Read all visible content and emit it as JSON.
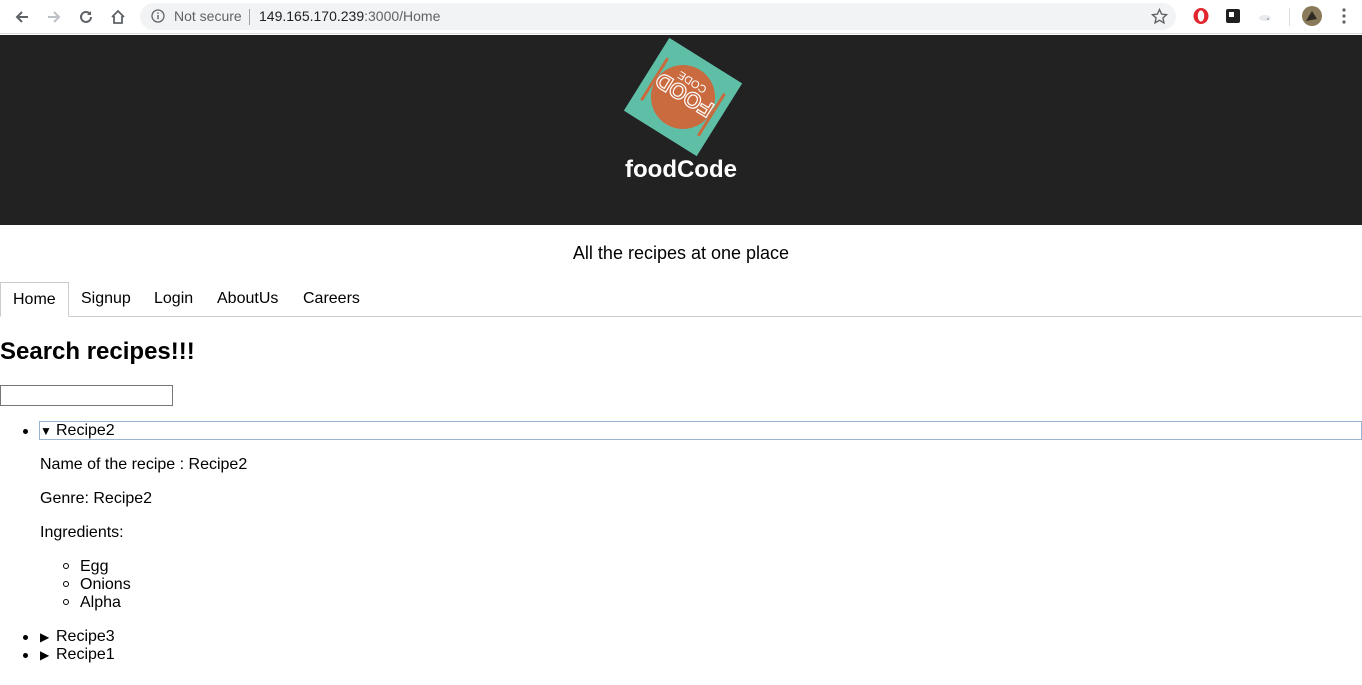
{
  "browser": {
    "security_label": "Not secure",
    "url_host": "149.165.170.239",
    "url_rest": ":3000/Home",
    "icons": [
      "back-icon",
      "forward-icon",
      "reload-icon",
      "home-icon",
      "info-icon",
      "star-icon",
      "opera-icon",
      "extension-icon",
      "cloud-icon",
      "avatar-icon",
      "menu-icon"
    ]
  },
  "header": {
    "logo_text": "FOOD CODE",
    "title": "foodCode"
  },
  "tagline": "All the recipes at one place",
  "tabs": [
    {
      "label": "Home",
      "active": true
    },
    {
      "label": "Signup"
    },
    {
      "label": "Login"
    },
    {
      "label": "AboutUs"
    },
    {
      "label": "Careers"
    }
  ],
  "search": {
    "title": "Search recipes!!!",
    "value": ""
  },
  "recipes": [
    {
      "summary": "Recipe2",
      "expanded": true,
      "name_line": "Name of the recipe : Recipe2",
      "genre_line": "Genre: Recipe2",
      "ingredients_label": "Ingredients:",
      "ingredients": [
        "Egg",
        "Onions",
        "Alpha"
      ]
    },
    {
      "summary": "Recipe3",
      "expanded": false
    },
    {
      "summary": "Recipe1",
      "expanded": false
    }
  ],
  "colors": {
    "header_bg": "#222222",
    "logo_bg": "#5fbfa6",
    "logo_circle": "#c96a3f"
  }
}
